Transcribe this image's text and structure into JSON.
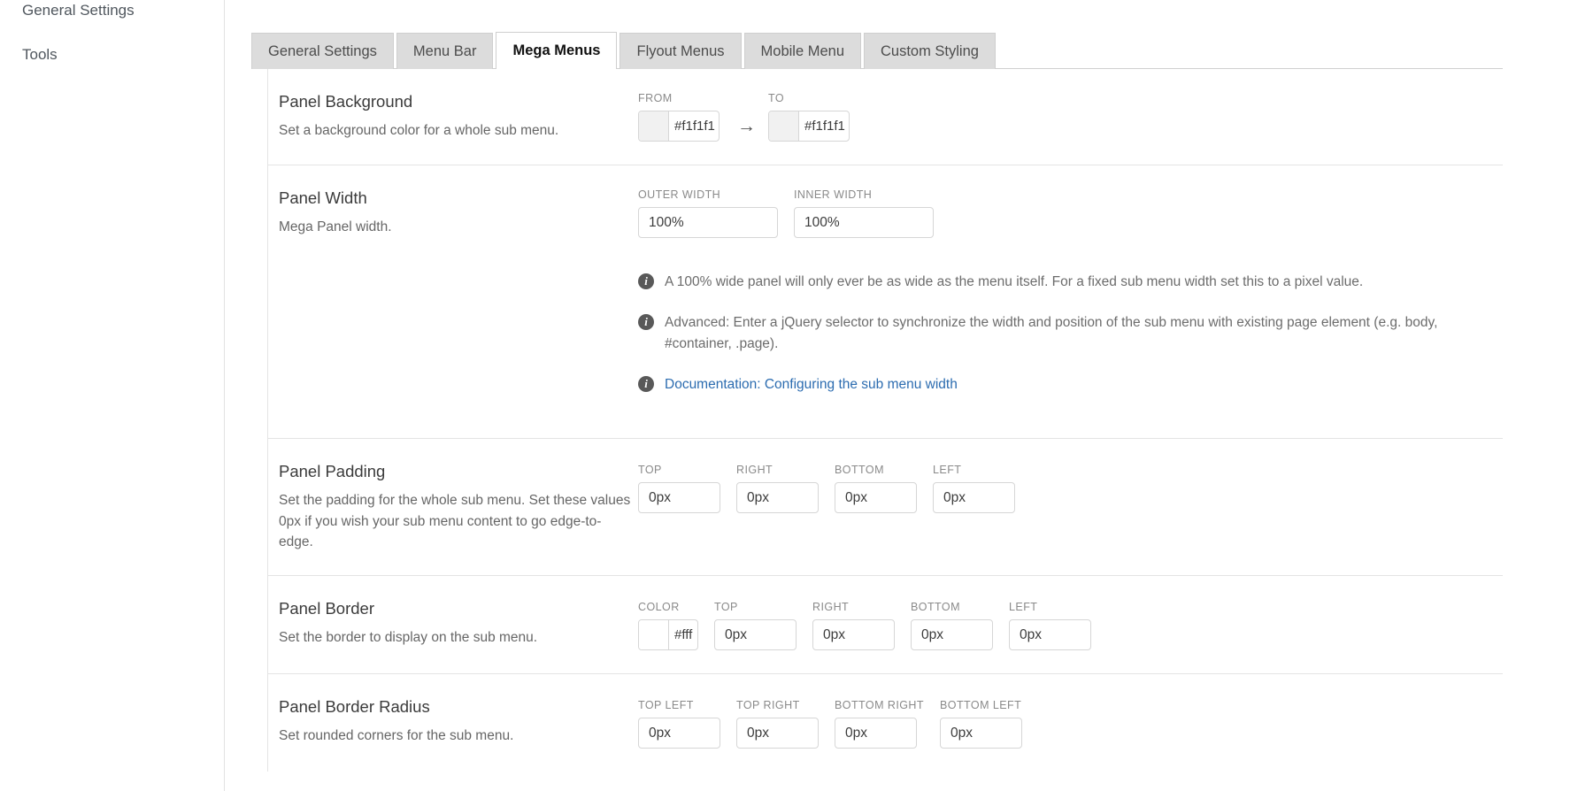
{
  "sidebar": {
    "items": [
      {
        "label": "General Settings"
      },
      {
        "label": "Tools"
      }
    ]
  },
  "tabs": [
    {
      "label": "General Settings",
      "active": false
    },
    {
      "label": "Menu Bar",
      "active": false
    },
    {
      "label": "Mega Menus",
      "active": true
    },
    {
      "label": "Flyout Menus",
      "active": false
    },
    {
      "label": "Mobile Menu",
      "active": false
    },
    {
      "label": "Custom Styling",
      "active": false
    }
  ],
  "sections": {
    "panel_background": {
      "title": "Panel Background",
      "description": "Set a background color for a whole sub menu.",
      "from_label": "FROM",
      "from_value": "#f1f1f1",
      "from_swatch": "#f1f1f1",
      "arrow": "→",
      "to_label": "TO",
      "to_value": "#f1f1f1",
      "to_swatch": "#f1f1f1"
    },
    "panel_width": {
      "title": "Panel Width",
      "description": "Mega Panel width.",
      "outer_label": "OUTER WIDTH",
      "outer_value": "100%",
      "inner_label": "INNER WIDTH",
      "inner_value": "100%",
      "info_1": "A 100% wide panel will only ever be as wide as the menu itself. For a fixed sub menu width set this to a pixel value.",
      "info_2": "Advanced: Enter a jQuery selector to synchronize the width and position of the sub menu with existing page element (e.g. body, #container, .page).",
      "info_3": "Documentation: Configuring the sub menu width"
    },
    "panel_padding": {
      "title": "Panel Padding",
      "description": "Set the padding for the whole sub menu. Set these values 0px if you wish your sub menu content to go edge-to-edge.",
      "fields": [
        {
          "label": "TOP",
          "value": "0px"
        },
        {
          "label": "RIGHT",
          "value": "0px"
        },
        {
          "label": "BOTTOM",
          "value": "0px"
        },
        {
          "label": "LEFT",
          "value": "0px"
        }
      ]
    },
    "panel_border": {
      "title": "Panel Border",
      "description": "Set the border to display on the sub menu.",
      "color_label": "COLOR",
      "color_value": "#fff",
      "color_swatch": "#ffffff",
      "fields": [
        {
          "label": "TOP",
          "value": "0px"
        },
        {
          "label": "RIGHT",
          "value": "0px"
        },
        {
          "label": "BOTTOM",
          "value": "0px"
        },
        {
          "label": "LEFT",
          "value": "0px"
        }
      ]
    },
    "panel_border_radius": {
      "title": "Panel Border Radius",
      "description": "Set rounded corners for the sub menu.",
      "fields": [
        {
          "label": "TOP LEFT",
          "value": "0px"
        },
        {
          "label": "TOP RIGHT",
          "value": "0px"
        },
        {
          "label": "BOTTOM RIGHT",
          "value": "0px"
        },
        {
          "label": "BOTTOM LEFT",
          "value": "0px"
        }
      ]
    }
  },
  "icons": {
    "info": "i"
  },
  "colors": {
    "link": "#2c6cb0",
    "tab_active_bg": "#ffffff",
    "tab_bg": "#dcdcdc",
    "info_icon_bg": "#595959"
  }
}
